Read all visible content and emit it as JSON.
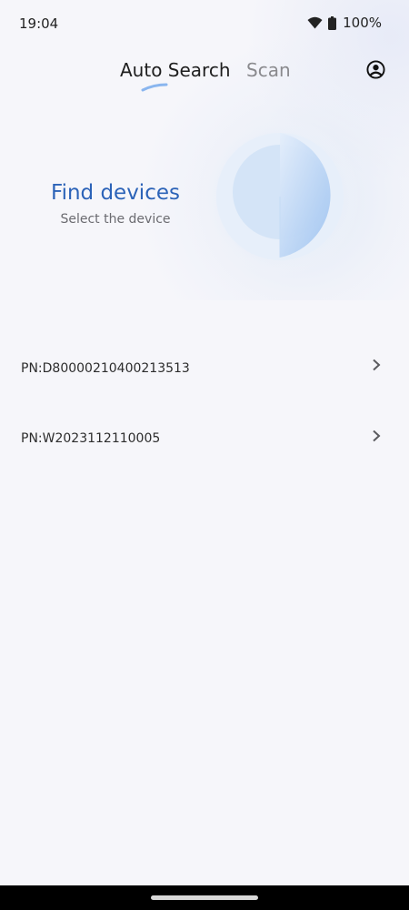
{
  "status_bar": {
    "time": "19:04",
    "battery": "100%",
    "icons": [
      "wifi-icon",
      "battery-icon"
    ]
  },
  "tabs": [
    {
      "label": "Auto Search",
      "active": true
    },
    {
      "label": "Scan",
      "active": false
    }
  ],
  "header": {
    "account_icon": "account-circle-icon"
  },
  "hero": {
    "title": "Find devices",
    "subtitle": "Select the device"
  },
  "devices": [
    {
      "label": "PN:D80000210400213513",
      "icon": "chevron-right-icon"
    },
    {
      "label": "PN:W2023112110005",
      "icon": "chevron-right-icon"
    }
  ],
  "colors": {
    "accent": "#2c63b8",
    "background": "#f6f6fa",
    "radar": "#a9c9f2"
  }
}
